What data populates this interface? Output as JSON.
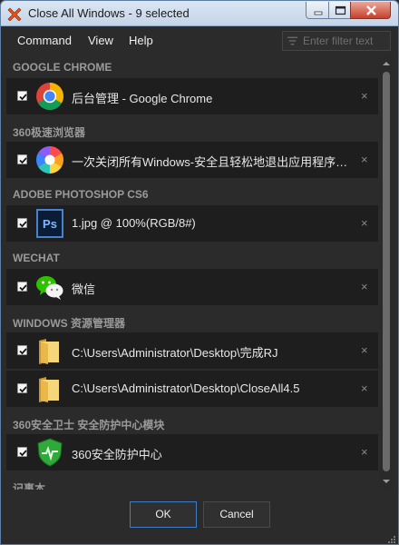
{
  "window": {
    "title": "Close All Windows - 9 selected",
    "icon": "close-x-app-icon"
  },
  "menu": {
    "command": "Command",
    "view": "View",
    "help": "Help"
  },
  "filter": {
    "placeholder": "Enter filter text",
    "value": ""
  },
  "groups": [
    {
      "name": "GOOGLE CHROME",
      "items": [
        {
          "label": "后台管理 - Google Chrome",
          "icon": "chrome-icon",
          "checked": true
        }
      ]
    },
    {
      "name": "360极速浏览器",
      "items": [
        {
          "label": "一次关闭所有Windows-安全且轻松地退出应用程序，然...",
          "icon": "360-browser-icon",
          "checked": true
        }
      ]
    },
    {
      "name": "ADOBE PHOTOSHOP CS6",
      "items": [
        {
          "label": "1.jpg @ 100%(RGB/8#)",
          "icon": "photoshop-icon",
          "checked": true
        }
      ]
    },
    {
      "name": "WECHAT",
      "items": [
        {
          "label": "微信",
          "icon": "wechat-icon",
          "checked": true
        }
      ]
    },
    {
      "name": "WINDOWS 资源管理器",
      "items": [
        {
          "label": "C:\\Users\\Administrator\\Desktop\\完成RJ",
          "icon": "folder-icon",
          "checked": true
        },
        {
          "label": "C:\\Users\\Administrator\\Desktop\\CloseAll4.5",
          "icon": "folder-icon",
          "checked": true
        }
      ]
    },
    {
      "name": "360安全卫士 安全防护中心模块",
      "items": [
        {
          "label": "360安全防护中心",
          "icon": "360-shield-icon",
          "checked": true
        }
      ]
    },
    {
      "name": "记事本",
      "items": []
    }
  ],
  "close_glyph": "×",
  "buttons": {
    "ok": "OK",
    "cancel": "Cancel"
  },
  "colors": {
    "accent": "#3d7fc6",
    "row_bg": "#1e1e1e",
    "window_bg": "#2b2b2b",
    "header_text": "#9a9a9a"
  }
}
